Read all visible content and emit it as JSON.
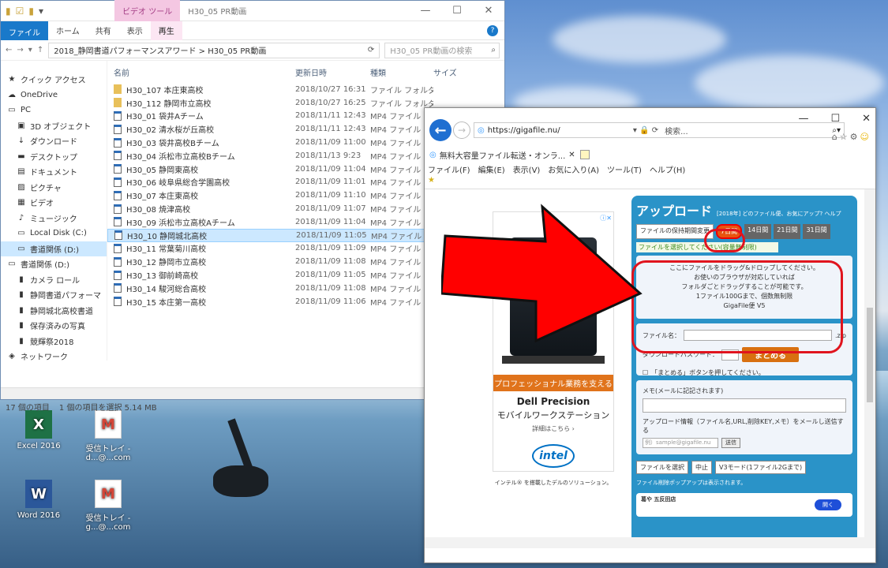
{
  "explorer": {
    "video_tools": "ビデオ ツール",
    "window_title": "H30_05 PR動画",
    "tabs": [
      "ファイル",
      "ホーム",
      "共有",
      "表示",
      "再生"
    ],
    "breadcrumb": "2018_静岡書道パフォーマンスアワード  >  H30_05 PR動画",
    "search_placeholder": "H30_05 PR動画の検索",
    "columns": [
      "名前",
      "更新日時",
      "種類",
      "サイズ"
    ],
    "nav": [
      {
        "label": "クイック アクセス",
        "icon": "★",
        "sub": false
      },
      {
        "label": "OneDrive",
        "icon": "☁",
        "sub": false
      },
      {
        "label": "PC",
        "icon": "▭",
        "sub": false
      },
      {
        "label": "3D オブジェクト",
        "icon": "▣",
        "sub": true
      },
      {
        "label": "ダウンロード",
        "icon": "↓",
        "sub": true
      },
      {
        "label": "デスクトップ",
        "icon": "▬",
        "sub": true
      },
      {
        "label": "ドキュメント",
        "icon": "▤",
        "sub": true
      },
      {
        "label": "ピクチャ",
        "icon": "▨",
        "sub": true
      },
      {
        "label": "ビデオ",
        "icon": "▦",
        "sub": true
      },
      {
        "label": "ミュージック",
        "icon": "♪",
        "sub": true
      },
      {
        "label": "Local Disk (C:)",
        "icon": "▭",
        "sub": true
      },
      {
        "label": "書道関係 (D:)",
        "icon": "▭",
        "sub": true
      },
      {
        "label": "書道関係 (D:)",
        "icon": "▭",
        "sub": false
      },
      {
        "label": "カメラ ロール",
        "icon": "▮",
        "sub": true
      },
      {
        "label": "静岡書道パフォーマ",
        "icon": "▮",
        "sub": true
      },
      {
        "label": "静岡城北高校書道",
        "icon": "▮",
        "sub": true
      },
      {
        "label": "保存済みの写真",
        "icon": "▮",
        "sub": true
      },
      {
        "label": "競輝祭2018",
        "icon": "▮",
        "sub": true
      },
      {
        "label": "ネットワーク",
        "icon": "◈",
        "sub": false
      }
    ],
    "files": [
      {
        "name": "H30_107 本庄東高校",
        "date": "2018/10/27 16:31",
        "type": "ファイル フォルダー",
        "kind": "folder"
      },
      {
        "name": "H30_112 静岡市立高校",
        "date": "2018/10/27 16:25",
        "type": "ファイル フォルダー",
        "kind": "folder"
      },
      {
        "name": "H30_01 袋井Aチーム",
        "date": "2018/11/11 12:43",
        "type": "MP4 ファイル",
        "kind": "mp4"
      },
      {
        "name": "H30_02 清水桜が丘高校",
        "date": "2018/11/11 12:43",
        "type": "MP4 ファイル",
        "kind": "mp4"
      },
      {
        "name": "H30_03 袋井高校Bチーム",
        "date": "2018/11/09 11:00",
        "type": "MP4 ファイル",
        "kind": "mp4"
      },
      {
        "name": "H30_04 浜松市立高校Bチーム",
        "date": "2018/11/13 9:23",
        "type": "MP4 ファイル",
        "kind": "mp4"
      },
      {
        "name": "H30_05 静岡東高校",
        "date": "2018/11/09 11:04",
        "type": "MP4 ファイル",
        "kind": "mp4"
      },
      {
        "name": "H30_06 岐阜県総合学園高校",
        "date": "2018/11/09 11:01",
        "type": "MP4 ファイル",
        "kind": "mp4"
      },
      {
        "name": "H30_07 本庄東高校",
        "date": "2018/11/09 11:10",
        "type": "MP4 ファイル",
        "kind": "mp4"
      },
      {
        "name": "H30_08 焼津高校",
        "date": "2018/11/09 11:07",
        "type": "MP4 ファイル",
        "kind": "mp4"
      },
      {
        "name": "H30_09 浜松市立高校Aチーム",
        "date": "2018/11/09 11:04",
        "type": "MP4 ファイル",
        "kind": "mp4"
      },
      {
        "name": "H30_10 静岡城北高校",
        "date": "2018/11/09 11:05",
        "type": "MP4 ファイル",
        "kind": "mp4",
        "selected": true
      },
      {
        "name": "H30_11 常葉菊川高校",
        "date": "2018/11/09 11:09",
        "type": "MP4 ファイル",
        "kind": "mp4"
      },
      {
        "name": "H30_12 静岡市立高校",
        "date": "2018/11/09 11:08",
        "type": "MP4 ファイル",
        "kind": "mp4"
      },
      {
        "name": "H30_13 御前崎高校",
        "date": "2018/11/09 11:05",
        "type": "MP4 ファイル",
        "kind": "mp4"
      },
      {
        "name": "H30_14 駿河総合高校",
        "date": "2018/11/09 11:08",
        "type": "MP4 ファイル",
        "kind": "mp4"
      },
      {
        "name": "H30_15 本庄第一高校",
        "date": "2018/11/09 11:06",
        "type": "MP4 ファイル",
        "kind": "mp4"
      }
    ],
    "status_count": "17 個の項目",
    "status_selected": "1 個の項目を選択  5.14 MB"
  },
  "desktop": {
    "icons": [
      {
        "label": "Excel 2016",
        "tile": "X"
      },
      {
        "label": "受信トレイ - d...@...com",
        "tile": "M"
      },
      {
        "label": "Word 2016",
        "tile": "W"
      },
      {
        "label": "受信トレイ - g...@...com",
        "tile": "M"
      }
    ]
  },
  "browser": {
    "url": "https://gigafile.nu/",
    "search_label": "検索...",
    "tab_title": "無料大容量ファイル転送・オンラ...",
    "menu": [
      "ファイル(F)",
      "編集(E)",
      "表示(V)",
      "お気に入り(A)",
      "ツール(T)",
      "ヘルプ(H)"
    ]
  },
  "ad": {
    "banner": "プロフェッショナル業務を支える",
    "brand": "Dell Precision",
    "subtitle": "モバイルワークステーション",
    "link": "詳細はこちら ›",
    "intel": "intel",
    "footer": "インテル® を搭載したデルのソリューション。"
  },
  "upload": {
    "title": "アップロード",
    "sub": "[2018年] どのファイル便、お気にアップ? ヘルプ",
    "keep_label": "ファイルの保持期間変更",
    "day_tabs": [
      "7日間",
      "14日間",
      "21日間",
      "31日間"
    ],
    "select_note": "ファイルを選択してください(容量無制限)",
    "drop_lines": [
      "ここにファイルをドラッグ&ドロップしてください。",
      "お使いのブラウザが対応していれば",
      "フォルダごとドラッグすることが可能です。",
      "1ファイル100Gまで、個数無制限",
      "GigaFile便 V5"
    ],
    "filename_label": "ファイル名：",
    "zip_label": ".zip",
    "password_label": "ダウンロードパスワード：",
    "matomeru": "まとめる",
    "matomeru_note": "「まとめる」ボタンを押してください。",
    "memo_label": "メモ(メールに記記されます)",
    "mail_desc": "アップロード情報（ファイル名,URL,削除KEY,メモ）をメールし送信する",
    "mail_placeholder": "例）sample@gigafile.nu",
    "send_label": "送信",
    "actions": [
      "ファイルを選択",
      "中止",
      "V3モード(1ファイル2Gまで)"
    ],
    "footer": "ファイル削除ポップアップは表示されます。",
    "ad_title": "葛や 五反田店",
    "ad_button": "開く"
  }
}
